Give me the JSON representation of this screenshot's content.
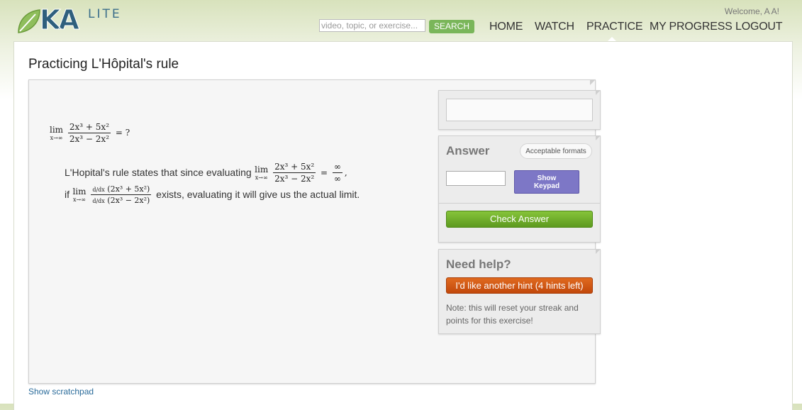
{
  "header": {
    "logo_text": "KA",
    "logo_lite": "LITE",
    "welcome": "Welcome, A A!",
    "search_placeholder": "video, topic, or exercise...",
    "search_button": "SEARCH",
    "nav": [
      "HOME",
      "WATCH",
      "PRACTICE",
      "MY PROGRESS",
      "LOGOUT"
    ],
    "active_nav": "PRACTICE"
  },
  "page": {
    "title": "Practicing L'Hôpital's rule"
  },
  "problem": {
    "lim_word": "lim",
    "lim_sub": "x→∞",
    "question_num": "2x³ + 5x²",
    "question_den": "2x³ − 2x²",
    "question_tail": "= ?",
    "hint_line1_text": "L'Hopital's rule states that since evaluating",
    "hint_result_num": "∞",
    "hint_result_den": "∞",
    "hint_if": "if",
    "deriv_num_prefix": "d/dx",
    "deriv_num_expr": "(2x³ + 5x²)",
    "deriv_den_expr": "(2x³ − 2x²)",
    "hint_line2_tail": "exists, evaluating it will give us the actual limit."
  },
  "answer_panel": {
    "heading": "Answer",
    "formats_button": "Acceptable formats",
    "keypad_line1": "Show",
    "keypad_line2": "Keypad",
    "check_button": "Check Answer"
  },
  "help_panel": {
    "heading": "Need help?",
    "hint_button": "I'd like another hint (4 hints left)",
    "note": "Note: this will reset your streak and points for this exercise!"
  },
  "footer": {
    "scratchpad_link": "Show scratchpad"
  },
  "colors": {
    "search_green": "#7ab65a",
    "check_green": "#5d9a1f",
    "hint_orange": "#c2480b",
    "keypad_purple": "#7d77c6",
    "link_blue": "#2a6b9a"
  }
}
